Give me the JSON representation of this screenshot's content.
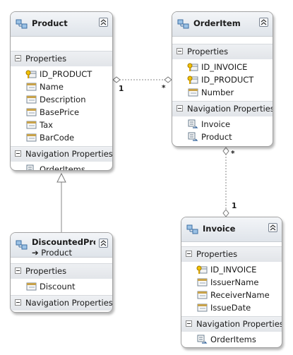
{
  "entities": {
    "product": {
      "name": "Product",
      "properties_label": "Properties",
      "properties": [
        "ID_PRODUCT",
        "Name",
        "Description",
        "BasePrice",
        "Tax",
        "BarCode"
      ],
      "navigation_label": "Navigation Properties",
      "navigation": [
        "OrderItems"
      ]
    },
    "orderitem": {
      "name": "OrderItem",
      "properties_label": "Properties",
      "properties": [
        "ID_INVOICE",
        "ID_PRODUCT",
        "Number"
      ],
      "navigation_label": "Navigation Properties",
      "navigation": [
        "Invoice",
        "Product"
      ]
    },
    "discounted": {
      "name": "DiscountedPro...",
      "base": "➔ Product",
      "properties_label": "Properties",
      "properties": [
        "Discount"
      ],
      "navigation_label": "Navigation Properties",
      "navigation": []
    },
    "invoice": {
      "name": "Invoice",
      "properties_label": "Properties",
      "properties": [
        "ID_INVOICE",
        "IssuerName",
        "ReceiverName",
        "IssueDate"
      ],
      "navigation_label": "Navigation Properties",
      "navigation": [
        "OrderItems"
      ]
    }
  },
  "associations": {
    "product_orderitem": {
      "from_multiplicity": "1",
      "to_multiplicity": "*"
    },
    "orderitem_invoice": {
      "from_multiplicity": "*",
      "to_multiplicity": "1"
    }
  },
  "colors": {
    "border": "#a3a3a3",
    "header": "#e6e9ee",
    "key": "#d9a300",
    "line": "#888888"
  }
}
